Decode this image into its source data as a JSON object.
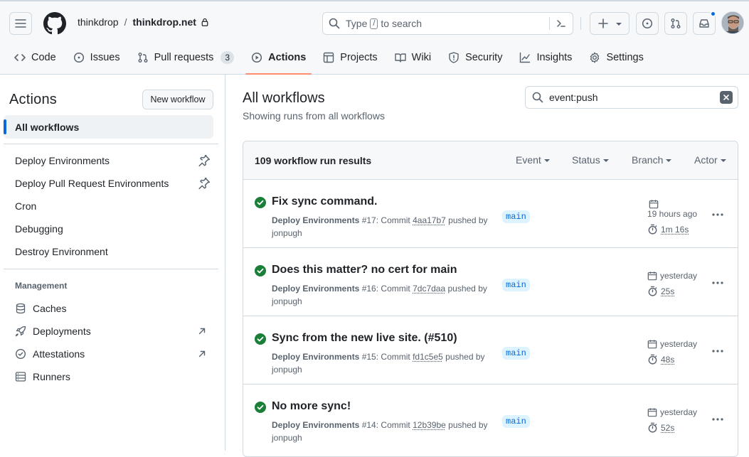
{
  "header": {
    "owner": "thinkdrop",
    "separator": "/",
    "repo": "thinkdrop.net",
    "search_pre": "Type",
    "search_key": "/",
    "search_post": "to search"
  },
  "nav": [
    {
      "label": "Code",
      "icon": "code-icon"
    },
    {
      "label": "Issues",
      "icon": "issue-icon"
    },
    {
      "label": "Pull requests",
      "icon": "pull-request-icon",
      "count": "3"
    },
    {
      "label": "Actions",
      "icon": "play-icon",
      "selected": true
    },
    {
      "label": "Projects",
      "icon": "table-icon"
    },
    {
      "label": "Wiki",
      "icon": "book-icon"
    },
    {
      "label": "Security",
      "icon": "shield-icon"
    },
    {
      "label": "Insights",
      "icon": "graph-icon"
    },
    {
      "label": "Settings",
      "icon": "gear-icon"
    }
  ],
  "sidebar": {
    "title": "Actions",
    "new_workflow": "New workflow",
    "all_workflows": "All workflows",
    "workflows": [
      {
        "label": "Deploy Environments",
        "pinned": true
      },
      {
        "label": "Deploy Pull Request Environments",
        "pinned": true
      },
      {
        "label": "Cron"
      },
      {
        "label": "Debugging"
      },
      {
        "label": "Destroy Environment"
      }
    ],
    "management_title": "Management",
    "management": [
      {
        "label": "Caches",
        "icon": "database-icon"
      },
      {
        "label": "Deployments",
        "icon": "rocket-icon",
        "external": true
      },
      {
        "label": "Attestations",
        "icon": "verified-icon",
        "external": true
      },
      {
        "label": "Runners",
        "icon": "server-icon"
      }
    ]
  },
  "main": {
    "title": "All workflows",
    "subtitle": "Showing runs from all workflows",
    "filter_value": "event:push",
    "results": "109 workflow run results",
    "filters": [
      "Event",
      "Status",
      "Branch",
      "Actor"
    ],
    "runs": [
      {
        "title": "Fix sync command.",
        "workflow": "Deploy Environments",
        "num": "#17",
        "commit_word": "Commit",
        "sha": "4aa17b7",
        "pushed": "pushed by",
        "actor": "jonpugh",
        "branch": "main",
        "when": "19 hours ago",
        "duration": "1m 16s"
      },
      {
        "title": "Does this matter? no cert for main",
        "workflow": "Deploy Environments",
        "num": "#16",
        "commit_word": "Commit",
        "sha": "7dc7daa",
        "pushed": "pushed by",
        "actor": "jonpugh",
        "branch": "main",
        "when": "yesterday",
        "duration": "25s"
      },
      {
        "title": "Sync from the new live site. (#510)",
        "workflow": "Deploy Environments",
        "num": "#15",
        "commit_word": "Commit",
        "sha": "fd1c5e5",
        "pushed": "pushed by",
        "actor": "jonpugh",
        "branch": "main",
        "when": "yesterday",
        "duration": "48s"
      },
      {
        "title": "No more sync!",
        "workflow": "Deploy Environments",
        "num": "#14",
        "commit_word": "Commit",
        "sha": "12b39be",
        "pushed": "pushed by",
        "actor": "jonpugh",
        "branch": "main",
        "when": "yesterday",
        "duration": "52s"
      }
    ]
  },
  "colors": {
    "accent": "#0969da",
    "success": "#1a7f37",
    "tab_underline": "#fd8c73"
  }
}
